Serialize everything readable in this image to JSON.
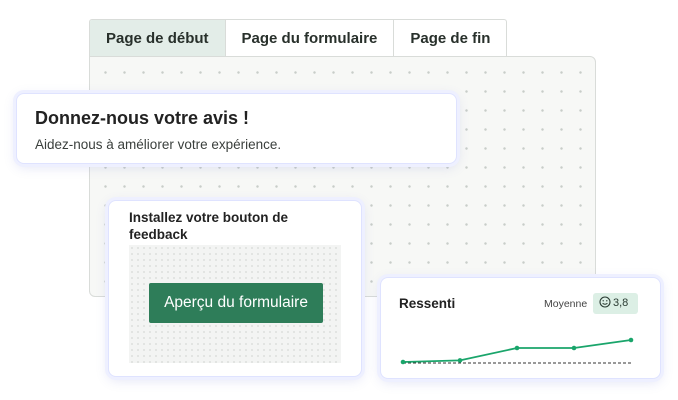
{
  "tabs": [
    "Page de début",
    "Page du formulaire",
    "Page de fin"
  ],
  "welcome": {
    "title": "Donnez-nous votre avis !",
    "subtitle": "Aidez-nous à améliorer votre expérience."
  },
  "install": {
    "title": "Installez votre bouton de feedback",
    "button_label": "Aperçu du formulaire"
  },
  "sentiment": {
    "title": "Ressenti",
    "average_label": "Moyenne",
    "average_value": "3,8",
    "badge_icon": "smiley-face-icon"
  },
  "colors": {
    "accent_green": "#2e7d59",
    "badge_bg": "#dcefe5",
    "line_green": "#1aa56b"
  },
  "chart_data": {
    "type": "line",
    "points": [
      {
        "x": 0,
        "y": 1.0
      },
      {
        "x": 1,
        "y": 1.4
      },
      {
        "x": 2,
        "y": 4.5
      },
      {
        "x": 3,
        "y": 4.5
      },
      {
        "x": 4,
        "y": 6.5
      }
    ],
    "baseline": 1.0,
    "grid": false,
    "xlabel": "",
    "ylabel": ""
  }
}
